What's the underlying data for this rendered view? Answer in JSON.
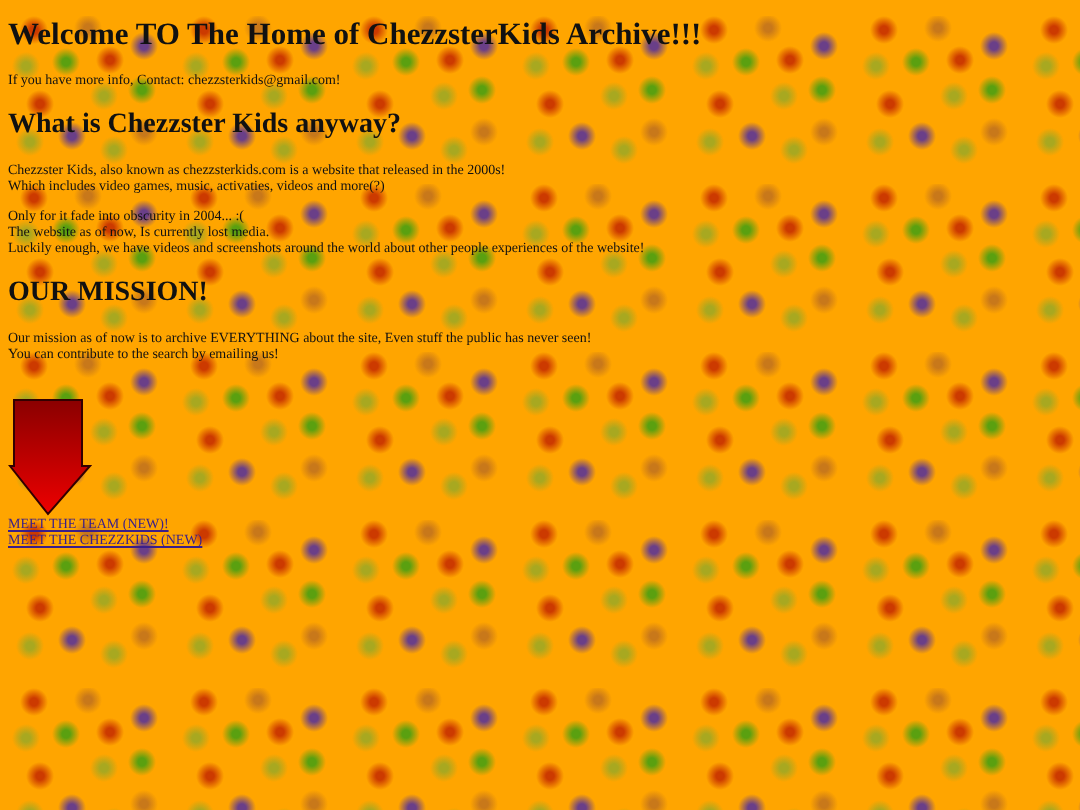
{
  "title": "Welcome TO The Home of ChezzsterKids Archive!!!",
  "contact": "If you have more info, Contact: chezzsterkids@gmail.com!",
  "sections": [
    {
      "heading": "What is Chezzster Kids anyway?",
      "paragraphs": [
        [
          "Chezzster Kids, also known as chezzsterkids.com is a website that released in the 2000s!",
          "Which includes video games, music, activaties, videos and more(?)"
        ],
        [
          "Only for it fade into obscurity in 2004... :(",
          "The website as of now, Is currently lost media.",
          "Luckily enough, we have videos and screenshots around the world about other people experiences of the website!"
        ]
      ]
    },
    {
      "heading": "OUR MISSION!",
      "paragraphs": [
        [
          "Our mission as of now is to archive EVERYTHING about the site, Even stuff the public has never seen!",
          "You can contribute to the search by emailing us!"
        ]
      ]
    }
  ],
  "links": [
    "MEET THE TEAM (NEW)!",
    "MEET THE CHEZZKIDS (NEW)"
  ]
}
